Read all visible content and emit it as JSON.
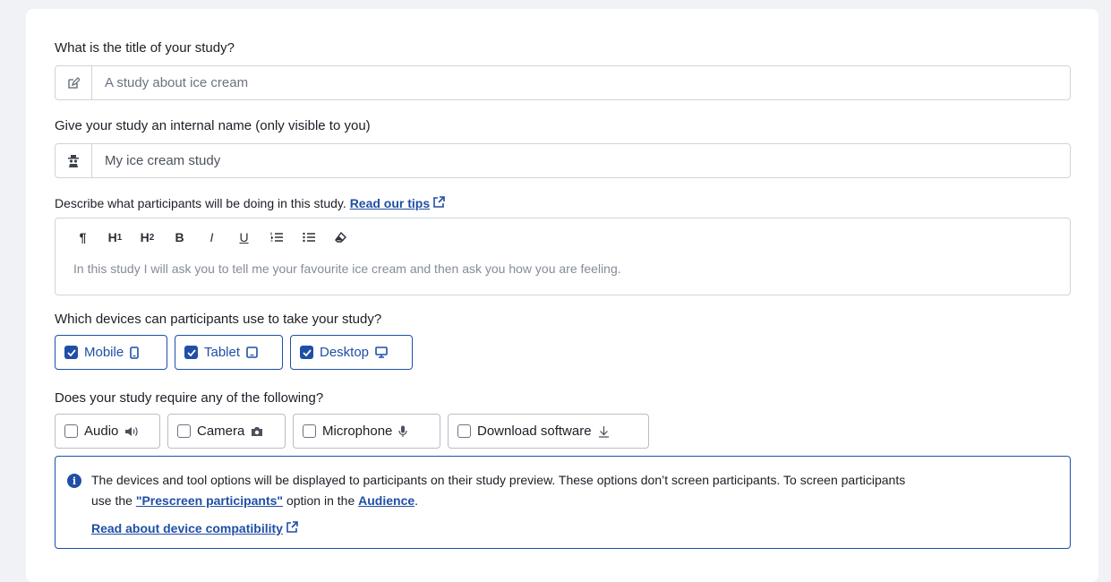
{
  "title_section": {
    "question": "What is the title of your study?",
    "placeholder": "A study about ice cream",
    "icon": "edit-icon"
  },
  "internal_name_section": {
    "question": "Give your study an internal name (only visible to you)",
    "placeholder": "My ice cream study",
    "icon": "spy-icon"
  },
  "description_section": {
    "question": "Describe what participants will be doing in this study.",
    "tips_link": "Read our tips",
    "toolbar": [
      "¶",
      "H1",
      "H2",
      "B",
      "I",
      "U",
      "ordered-list",
      "bullet-list",
      "eraser"
    ],
    "placeholder": "In this study I will ask you to tell me your favourite ice cream and then ask you how you are feeling."
  },
  "devices_section": {
    "question": "Which devices can participants use to take your study?",
    "options": [
      {
        "label": "Mobile",
        "checked": true,
        "icon": "mobile-icon"
      },
      {
        "label": "Tablet",
        "checked": true,
        "icon": "tablet-icon"
      },
      {
        "label": "Desktop",
        "checked": true,
        "icon": "desktop-icon"
      }
    ]
  },
  "requirements_section": {
    "question": "Does your study require any of the following?",
    "options": [
      {
        "label": "Audio",
        "checked": false,
        "icon": "speaker-icon"
      },
      {
        "label": "Camera",
        "checked": false,
        "icon": "camera-icon"
      },
      {
        "label": "Microphone",
        "checked": false,
        "icon": "microphone-icon"
      },
      {
        "label": "Download software",
        "checked": false,
        "icon": "download-icon"
      }
    ]
  },
  "info_box": {
    "text1": "The devices and tool options will be displayed to participants on their study preview. These options don’t screen participants. To screen participants",
    "text2_prefix": "use the ",
    "prescreen_link": "\"Prescreen participants\"",
    "text2_middle": " option in the ",
    "audience_link": "Audience",
    "text2_suffix": ".",
    "compat_link": "Read about device compatibility"
  },
  "colors": {
    "accent": "#1f4fa6",
    "border": "#cfd4db",
    "background": "#f0f2f5"
  }
}
